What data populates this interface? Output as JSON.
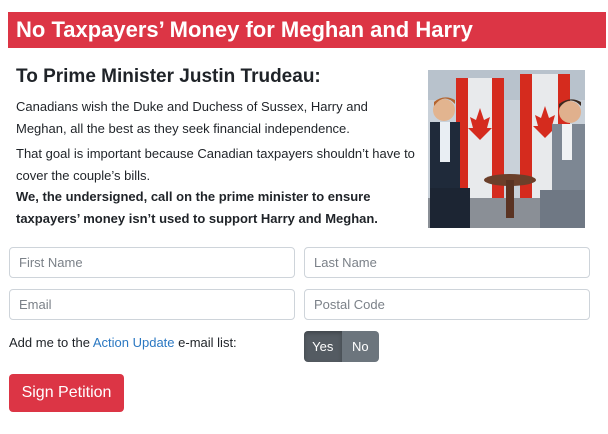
{
  "header": {
    "title": "No Taxpayers’ Money for Meghan and Harry"
  },
  "petition": {
    "addressee": "To Prime Minister Justin Trudeau:",
    "paragraph_1": "Canadians wish the Duke and Duchess of Sussex, Harry and Meghan, all the best as they seek financial independence.",
    "paragraph_2": "That goal is important because Canadian taxpayers shouldn’t have to cover the couple’s bills.",
    "paragraph_3": "We, the undersigned, call on the prime minister to ensure taxpayers’ money isn’t used to support Harry and Meghan."
  },
  "form": {
    "first_name_placeholder": "First Name",
    "last_name_placeholder": "Last Name",
    "email_placeholder": "Email",
    "postal_code_placeholder": "Postal Code",
    "optin_prefix": "Add me to the",
    "optin_link": "Action Update",
    "optin_suffix": "e-mail list:",
    "toggle_yes": "Yes",
    "toggle_no": "No",
    "toggle_selected": "Yes",
    "submit_label": "Sign Petition"
  },
  "colors": {
    "brand_red": "#dc3545",
    "link_blue": "#2b78c2",
    "toggle_gray": "#6c757d"
  }
}
